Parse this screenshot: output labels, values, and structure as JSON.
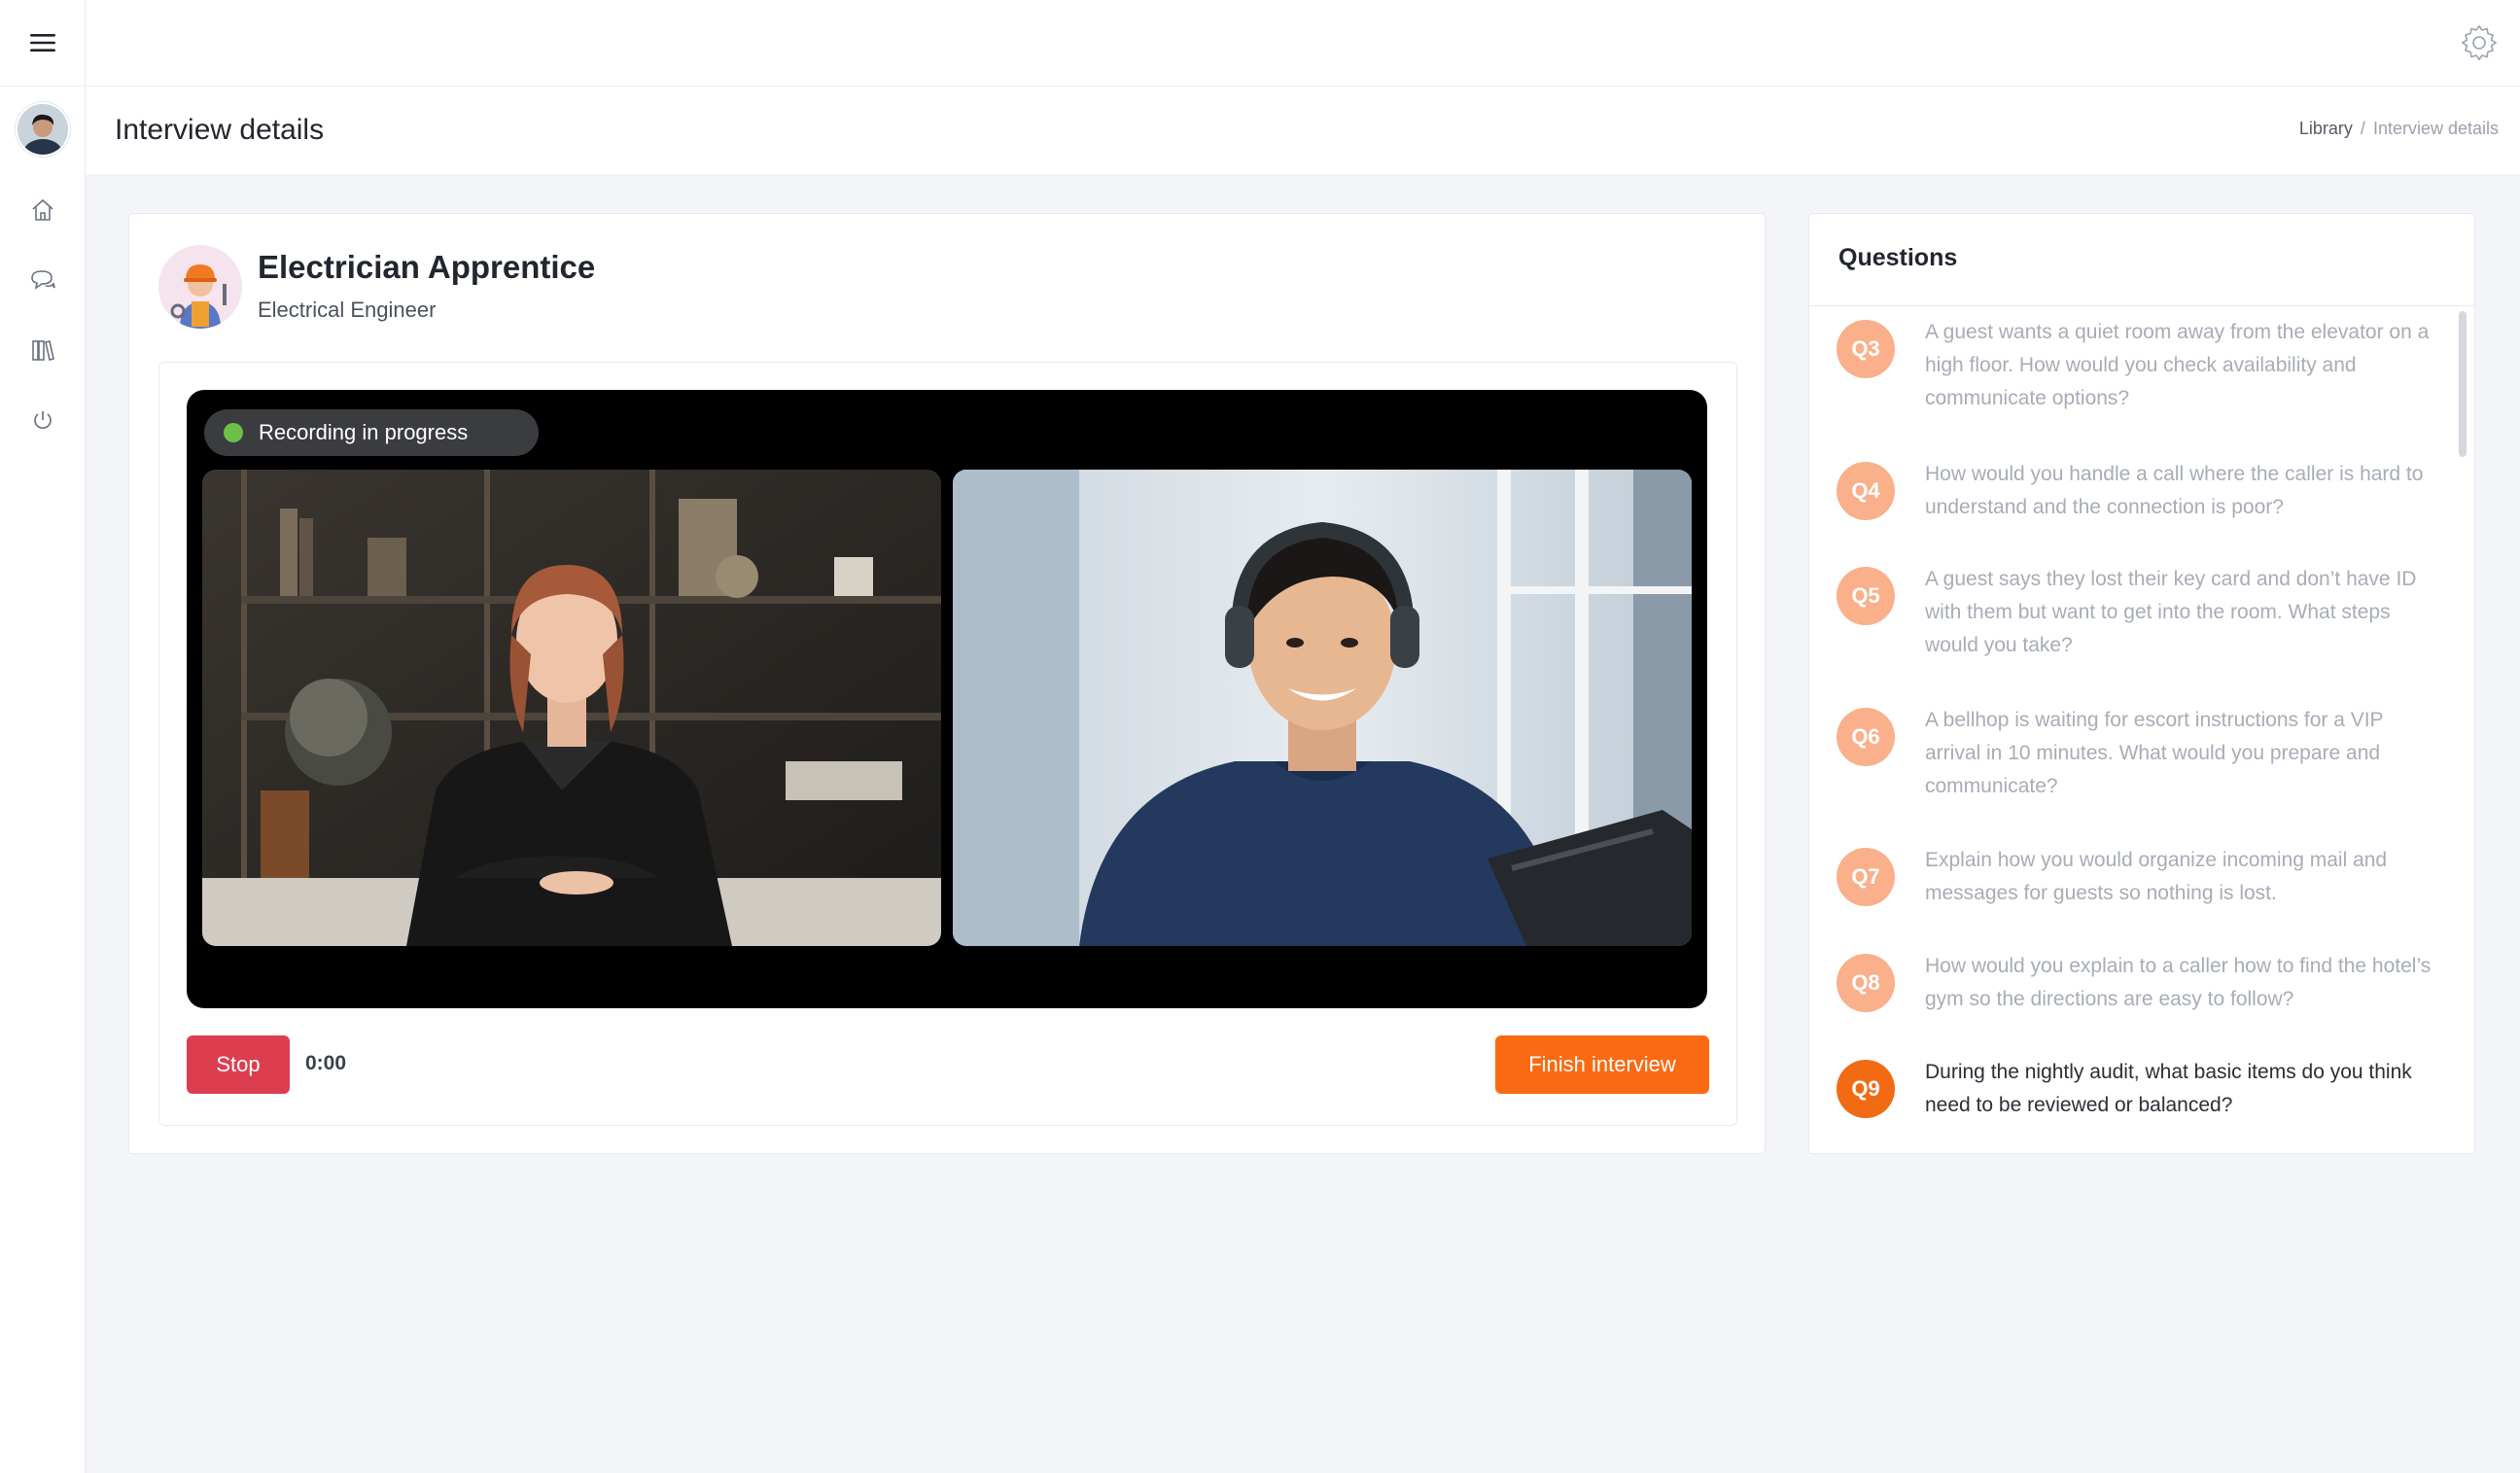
{
  "page": {
    "title": "Interview details"
  },
  "breadcrumb": {
    "items": [
      "Library",
      "Interview details"
    ]
  },
  "icons": {
    "menu": "menu-icon",
    "home": "home-icon",
    "chat": "chat-icon",
    "library": "library-icon",
    "power": "power-icon",
    "settings": "gear-icon"
  },
  "role": {
    "title": "Electrician Apprentice",
    "subtitle": "Electrical Engineer"
  },
  "recording": {
    "status": "Recording in progress"
  },
  "controls": {
    "stop_label": "Stop",
    "timer": "0:00",
    "finish_label": "Finish interview"
  },
  "questions": {
    "title": "Questions",
    "items": [
      {
        "id": "Q3",
        "text": "A guest wants a quiet room away from the elevator on a high floor. How would you check availability and communicate options?"
      },
      {
        "id": "Q4",
        "text": "How would you handle a call where the caller is hard to understand and the connection is poor?"
      },
      {
        "id": "Q5",
        "text": "A guest says they lost their key card and don’t have ID with them but want to get into the room. What steps would you take?"
      },
      {
        "id": "Q6",
        "text": "A bellhop is waiting for escort instructions for a VIP arrival in 10 minutes. What would you prepare and communicate?"
      },
      {
        "id": "Q7",
        "text": "Explain how you would organize incoming mail and messages for guests so nothing is lost."
      },
      {
        "id": "Q8",
        "text": "How would you explain to a caller how to find the hotel’s gym so the directions are easy to follow?"
      },
      {
        "id": "Q9",
        "text": "During the nightly audit, what basic items do you think need to be reviewed or balanced?",
        "active": true
      }
    ]
  },
  "colors": {
    "accent": "#fa6a12",
    "stop": "#dc3e50",
    "badge": "#f9b08b",
    "badge_active": "#f26a14",
    "recording_dot": "#6cc04a"
  }
}
